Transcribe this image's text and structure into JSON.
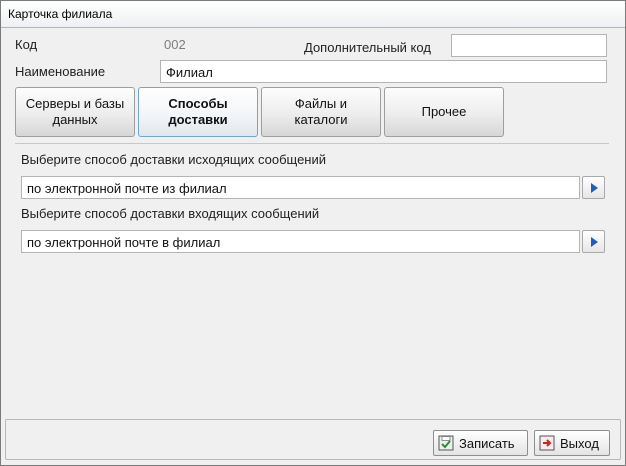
{
  "window": {
    "title": "Карточка филиала"
  },
  "form": {
    "code_label": "Код",
    "code_value": "002",
    "extra_code_label": "Дополнительный код",
    "extra_code_value": "",
    "name_label": "Наименование",
    "name_value": "Филиал"
  },
  "tabs": [
    {
      "line1": "Серверы и базы",
      "line2": "данных",
      "active": false
    },
    {
      "line1": "Способы",
      "line2": "доставки",
      "active": true
    },
    {
      "line1": "Файлы и",
      "line2": "каталоги",
      "active": false
    },
    {
      "line1": "Прочее",
      "line2": "",
      "active": false
    }
  ],
  "delivery": {
    "outgoing_label": "Выберите способ доставки исходящих сообщений",
    "outgoing_value": "по электронной почте из филиал",
    "incoming_label": "Выберите способ доставки входящих сообщений",
    "incoming_value": "по электронной почте в филиал"
  },
  "buttons": {
    "save": "Записать",
    "exit": "Выход"
  },
  "colors": {
    "accent": "#1c5fbf",
    "active_tab_border": "#6fa6d6",
    "save_icon": "#2e8b3e",
    "exit_icon": "#c62828"
  },
  "icons": {
    "select": "arrow-right-icon",
    "save": "save-icon",
    "exit": "exit-icon"
  }
}
